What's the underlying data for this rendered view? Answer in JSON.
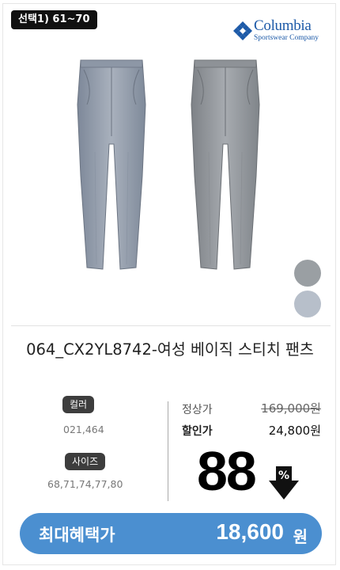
{
  "badge": "선택1) 61~70",
  "brand": {
    "name": "Columbia",
    "tagline": "Sportswear Company",
    "color": "#1d5aa8"
  },
  "product": {
    "title": "064_CX2YL8742-여성 베이직 스티치 팬츠",
    "swatch_colors": [
      "#9a9fa3",
      "#b7bfca"
    ]
  },
  "options": {
    "color_label": "컬러",
    "color_values": "021,464",
    "size_label": "사이즈",
    "size_values": "68,71,74,77,80"
  },
  "price": {
    "regular_label": "정상가",
    "regular_value": "169,000원",
    "sale_label": "할인가",
    "sale_value": "24,800원",
    "discount_rate": "88",
    "discount_unit": "%"
  },
  "cta": {
    "label": "최대혜택가",
    "price": "18,600",
    "unit": "원",
    "color": "#4b8fd0"
  }
}
